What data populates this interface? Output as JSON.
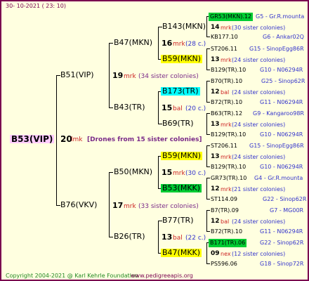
{
  "header": {
    "date": "30- 10-2021 ( 23: 10)"
  },
  "footer": {
    "copyright": "Copyright 2004-2021 @ Karl Kehrle Foundation",
    "website": "www.pedigreeapis.org"
  },
  "root": {
    "name": "B53(VIP)",
    "num": "20",
    "unit": "lmk",
    "note": "[Drones from 15 sister colonies]"
  },
  "parents": [
    {
      "name": "B51(VIP)",
      "num": "19",
      "unit": "mrk",
      "note": "(34 sister colonies)"
    },
    {
      "name": "B76(VKV)",
      "num": "17",
      "unit": "mrk",
      "note": "(33 sister colonies)"
    }
  ],
  "grand": [
    {
      "name": "B47(MKN)",
      "num": "16",
      "unit": "mrk",
      "note": "(28 c.)"
    },
    {
      "name": "B43(TR)",
      "num": "15",
      "unit": "bal",
      "note": "(20 c.)"
    },
    {
      "name": "B50(MKN)",
      "num": "15",
      "unit": "mrk",
      "note": "(30 c.)"
    },
    {
      "name": "B26(TR)",
      "num": "13",
      "unit": "bal",
      "note": "(22 c.)"
    }
  ],
  "great": [
    {
      "name": "B143(MKN)"
    },
    {
      "name": "B59(MKN)"
    },
    {
      "name": "B173(TR)"
    },
    {
      "name": "B69(TR)"
    },
    {
      "name": "B59(MKN)"
    },
    {
      "name": "B53(MKK)"
    },
    {
      "name": "B77(TR)"
    },
    {
      "name": "B47(MKK)"
    }
  ],
  "col4": [
    {
      "top": "GR53(MKN).12",
      "top_info": "G5 - Gr.R.mounta",
      "num": "14",
      "unit": "mrk",
      "note": "(30 sister colonies)",
      "bottom": "KB177.10",
      "bottom_info": "G6 - Ankar02Q"
    },
    {
      "top": "ST206.11",
      "top_info": "G15 - SinopEgg86R",
      "num": "13",
      "unit": "mrk",
      "note": "(24 sister colonies)",
      "bottom": "B129(TR).10",
      "bottom_info": "G10 - N06294R"
    },
    {
      "top": "B70(TR).10",
      "top_info": "G25 - Sinop62R",
      "num": "12",
      "unit": "bal",
      "note": "(24 sister colonies)",
      "bottom": "B72(TR).10",
      "bottom_info": "G11 - N06294R"
    },
    {
      "top": "B63(TR).12",
      "top_info": "G9 - Kangaroo98R",
      "num": "13",
      "unit": "mrk",
      "note": "(24 sister colonies)",
      "bottom": "B129(TR).10",
      "bottom_info": "G10 - N06294R"
    },
    {
      "top": "ST206.11",
      "top_info": "G15 - SinopEgg86R",
      "num": "13",
      "unit": "mrk",
      "note": "(24 sister colonies)",
      "bottom": "B129(TR).10",
      "bottom_info": "G10 - N06294R"
    },
    {
      "top": "GR73(TR).10",
      "top_info": "G4 - Gr.R.mounta",
      "num": "12",
      "unit": "mrk",
      "note": "(21 sister colonies)",
      "bottom": "ST114.09",
      "bottom_info": "G22 - Sinop62R"
    },
    {
      "top": "B7(TR).09",
      "top_info": "G7 - MG00R",
      "num": "12",
      "unit": "bal",
      "note": "(24 sister colonies)",
      "bottom": "B72(TR).10",
      "bottom_info": "G11 - N06294R"
    },
    {
      "top": "B171(TR).06",
      "top_info": "G22 - Sinop62R",
      "num": "09",
      "unit": "nex",
      "note": "(12 sister colonies)",
      "bottom": "PS596.06",
      "bottom_info": "G18 - Sinop72R"
    }
  ],
  "colors": {
    "frame": "#7a0050",
    "bg": "#ffffe0",
    "root_box": "#ffccff",
    "yellow": "#ffff00",
    "cyan": "#00ffff",
    "green": "#00cc33"
  }
}
